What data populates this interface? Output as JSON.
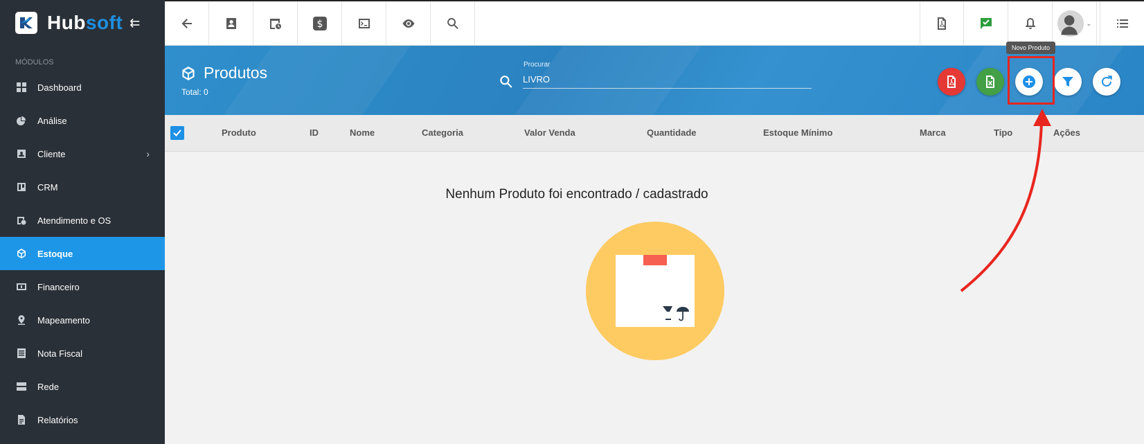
{
  "app": {
    "name_part1": "Hub",
    "name_part2": "soft",
    "collapse_glyph": "⇇"
  },
  "sidebar": {
    "section_label": "MÓDULOS",
    "items": [
      {
        "label": "Dashboard",
        "icon": "dashboard-icon"
      },
      {
        "label": "Análise",
        "icon": "pie-chart-icon"
      },
      {
        "label": "Cliente",
        "icon": "contact-card-icon",
        "has_children": true
      },
      {
        "label": "CRM",
        "icon": "kanban-icon"
      },
      {
        "label": "Atendimento e OS",
        "icon": "calendar-clock-icon"
      },
      {
        "label": "Estoque",
        "icon": "box-icon",
        "active": true
      },
      {
        "label": "Financeiro",
        "icon": "dollar-icon"
      },
      {
        "label": "Mapeamento",
        "icon": "map-pin-icon"
      },
      {
        "label": "Nota Fiscal",
        "icon": "receipt-icon"
      },
      {
        "label": "Rede",
        "icon": "server-icon"
      },
      {
        "label": "Relatórios",
        "icon": "report-icon"
      }
    ]
  },
  "topbar": {
    "left_icons": [
      "back-arrow-icon",
      "contact-icon",
      "calendar-clock-icon",
      "dollar-icon",
      "terminal-icon",
      "eye-icon",
      "search-icon"
    ],
    "right_icons": [
      "pdf-icon",
      "chat-check-icon",
      "bell-icon",
      "avatar",
      "list-icon"
    ]
  },
  "header": {
    "title": "Produtos",
    "total": "Total: 0",
    "search_label": "Procurar",
    "search_value": "LIVRO",
    "tooltip": "Novo Produto"
  },
  "table": {
    "columns": [
      "Produto",
      "ID",
      "Nome",
      "Categoria",
      "Valor Venda",
      "Quantidade",
      "Estoque Mínimo",
      "Marca",
      "Tipo",
      "Ações"
    ]
  },
  "empty_state": {
    "message": "Nenhum Produto foi encontrado / cadastrado"
  },
  "colors": {
    "sidebar": "#2a3037",
    "active": "#1e96e8",
    "header": "#2e8bc9",
    "pdf": "#e53935",
    "excel": "#43a047",
    "annotation": "#e8261f"
  }
}
